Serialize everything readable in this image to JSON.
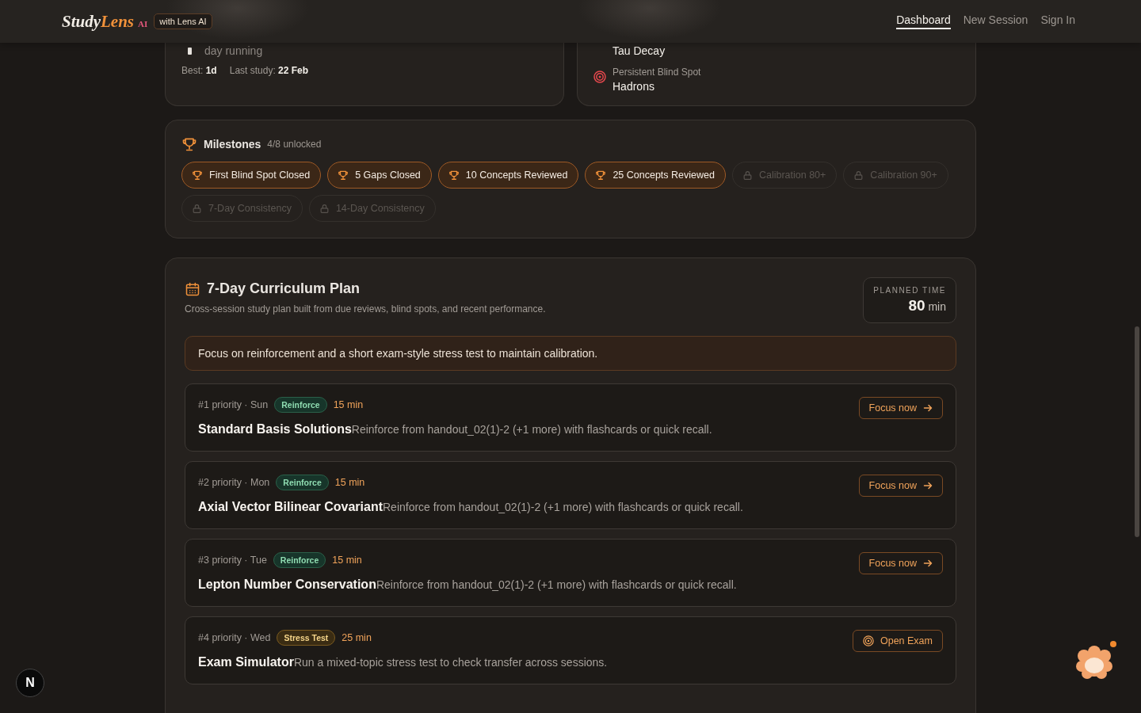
{
  "header": {
    "logo": {
      "first": "Study",
      "second": "Lens",
      "suffix": "AI"
    },
    "badge": "with Lens AI",
    "nav": [
      {
        "label": "Dashboard",
        "selected": true
      },
      {
        "label": "New Session",
        "selected": false
      },
      {
        "label": "Sign In",
        "selected": false
      }
    ]
  },
  "streak_card": {
    "text": "day running",
    "best_label": "Best:",
    "best": "1d",
    "last_label": "Last study:",
    "last": "22 Feb"
  },
  "focus_card": {
    "topic": "Tau Decay",
    "blind_spot_label": "Persistent Blind Spot",
    "blind_spot": "Hadrons"
  },
  "milestones": {
    "title": "Milestones",
    "count": "4/8 unlocked",
    "items": [
      {
        "label": "First Blind Spot Closed",
        "unlocked": true
      },
      {
        "label": "5 Gaps Closed",
        "unlocked": true
      },
      {
        "label": "10 Concepts Reviewed",
        "unlocked": true
      },
      {
        "label": "25 Concepts Reviewed",
        "unlocked": true
      },
      {
        "label": "Calibration 80+",
        "unlocked": false
      },
      {
        "label": "Calibration 90+",
        "unlocked": false
      },
      {
        "label": "7-Day Consistency",
        "unlocked": false
      },
      {
        "label": "14-Day Consistency",
        "unlocked": false
      }
    ]
  },
  "plan": {
    "title": "7-Day Curriculum Plan",
    "subtitle": "Cross-session study plan built from due reviews, blind spots, and recent performance.",
    "planned_time": {
      "label": "PLANNED TIME",
      "value": "80",
      "unit": "min"
    },
    "summary": "Focus on reinforcement and a short exam-style stress test to maintain calibration.",
    "items": [
      {
        "rank": "#1 priority · Sun",
        "kind": "reinforce",
        "tag": "Reinforce",
        "duration": "15 min",
        "title": "Standard Basis Solutions",
        "description": "Reinforce from handout_02(1)-2 (+1 more) with flashcards or quick recall.",
        "action": {
          "kind": "focus",
          "label": "Focus now"
        }
      },
      {
        "rank": "#2 priority · Mon",
        "kind": "reinforce",
        "tag": "Reinforce",
        "duration": "15 min",
        "title": "Axial Vector Bilinear Covariant",
        "description": "Reinforce from handout_02(1)-2 (+1 more) with flashcards or quick recall.",
        "action": {
          "kind": "focus",
          "label": "Focus now"
        }
      },
      {
        "rank": "#3 priority · Tue",
        "kind": "reinforce",
        "tag": "Reinforce",
        "duration": "15 min",
        "title": "Lepton Number Conservation",
        "description": "Reinforce from handout_02(1)-2 (+1 more) with flashcards or quick recall.",
        "action": {
          "kind": "focus",
          "label": "Focus now"
        }
      },
      {
        "rank": "#4 priority · Wed",
        "kind": "stress",
        "tag": "Stress Test",
        "duration": "25 min",
        "title": "Exam Simulator",
        "description": "Run a mixed-topic stress test to check transfer across sessions.",
        "action": {
          "kind": "exam",
          "label": "Open Exam"
        }
      }
    ]
  },
  "dev_badge": "N"
}
